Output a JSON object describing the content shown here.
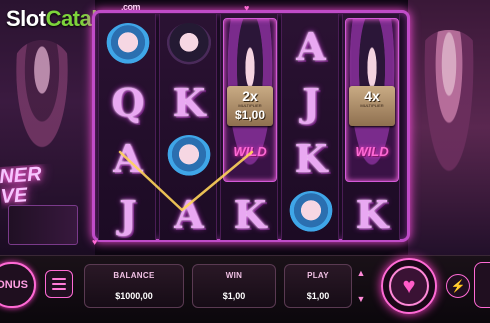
{
  "logo": {
    "slot": "Slot",
    "catalog": "Catalog",
    "com": ".com"
  },
  "background": {
    "sign_text": "NER\nVE"
  },
  "reels": [
    {
      "symbols": [
        "chibi-blue",
        "Q",
        "A",
        "J"
      ]
    },
    {
      "symbols": [
        "chibi-dark",
        "K",
        "chibi-blue",
        "A"
      ]
    },
    {
      "symbols": [
        "multiplier-wild",
        "K"
      ]
    },
    {
      "symbols": [
        "A",
        "J",
        "K",
        "chibi-blue"
      ]
    },
    {
      "symbols": [
        "multiplier-wild",
        "K"
      ]
    }
  ],
  "multipliers": [
    {
      "reel": 3,
      "value": "2x",
      "caption": "MULTIPLIER",
      "amount": "$1,00",
      "wild": "WILD"
    },
    {
      "reel": 5,
      "value": "4x",
      "caption": "MULTIPLIER",
      "amount": "",
      "wild": "WILD"
    }
  ],
  "controls": {
    "bonus_label": "ONUS",
    "balance_label": "BALANCE",
    "balance_value": "$1000,00",
    "win_label": "WIN",
    "win_value": "$1,00",
    "play_label": "PLAY",
    "play_value": "$1,00",
    "arrow_up": "▲",
    "arrow_down": "▼",
    "spin_icon": "♥",
    "turbo_icon": "⚡"
  },
  "colors": {
    "accent": "#ff6ad5",
    "frame": "#c04cc8",
    "logo_green": "#7dd33b"
  }
}
